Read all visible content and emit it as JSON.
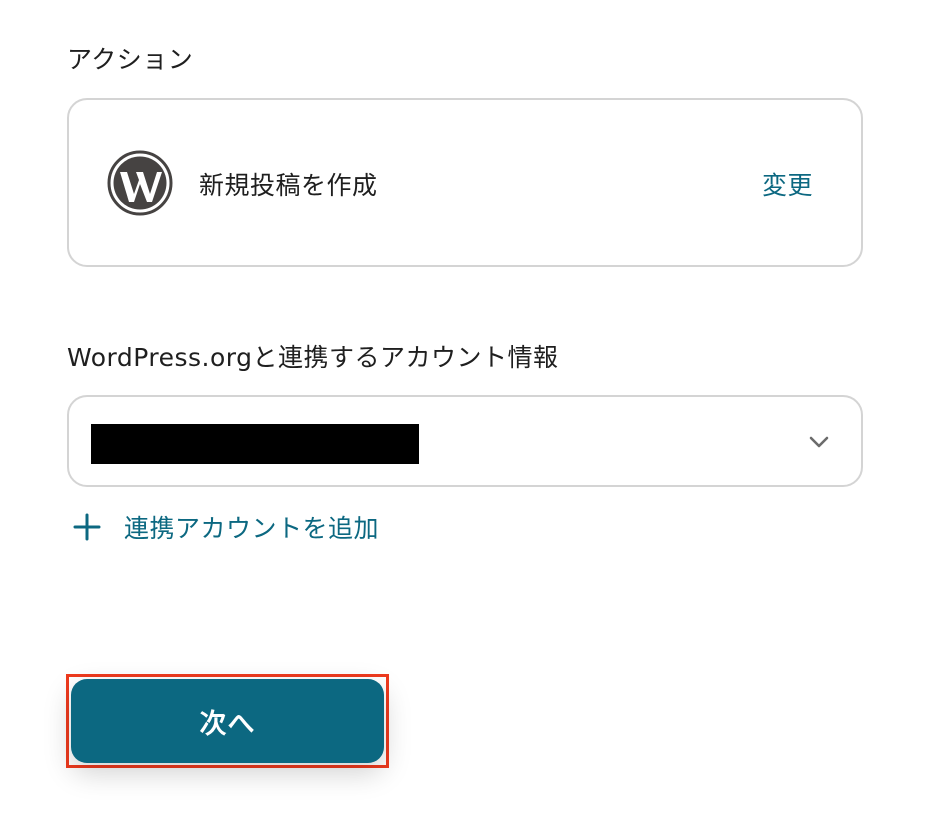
{
  "action": {
    "heading": "アクション",
    "icon": "wordpress-icon",
    "name": "新規投稿を作成",
    "change_label": "変更"
  },
  "account": {
    "heading": "WordPress.orgと連携するアカウント情報",
    "selected_value_redacted": true,
    "add_account_label": "連携アカウントを追加"
  },
  "footer": {
    "next_label": "次へ"
  },
  "colors": {
    "accent": "#0c6881",
    "highlight_border": "#ee3a1e",
    "card_border": "#d4d4d4",
    "wordpress_logo": "#464342"
  }
}
